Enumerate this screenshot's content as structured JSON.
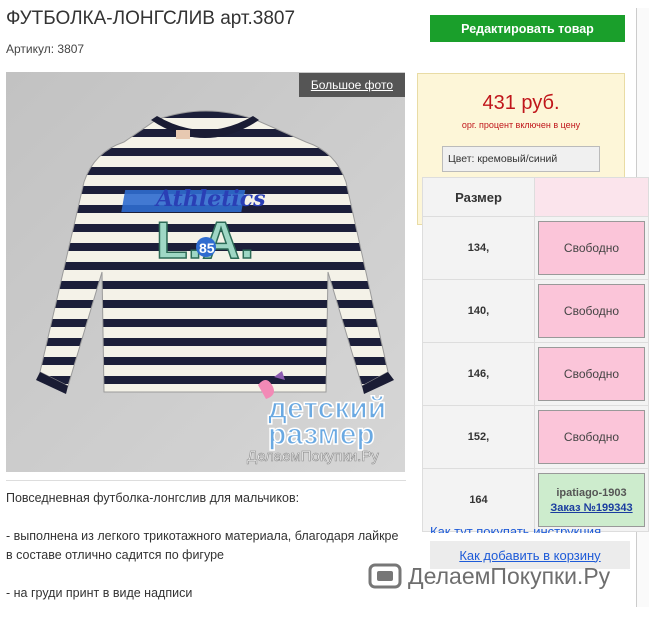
{
  "product": {
    "title": "ФУТБОЛКА-ЛОНГСЛИВ арт.3807",
    "sku": "Артикул: 3807",
    "big_photo": "Большое фото"
  },
  "image_text": {
    "brand_line1": "детский",
    "brand_line2": "размер",
    "brand_site": "ДелаемПокупки.Ру"
  },
  "actions": {
    "edit": "Редактировать товар"
  },
  "price": {
    "value": "431 руб.",
    "note": "орг. процент включен в цену",
    "color_label": "Цвет:",
    "color_value": "кремовый/синий"
  },
  "sizes": {
    "header": "Размер",
    "rows": [
      {
        "size": "134,",
        "status": "Свободно"
      },
      {
        "size": "140,",
        "status": "Свободно"
      },
      {
        "size": "146,",
        "status": "Свободно"
      },
      {
        "size": "152,",
        "status": "Свободно"
      },
      {
        "size": "164",
        "user": "ipatiago-1903",
        "order": "Заказ №199343"
      }
    ]
  },
  "links": {
    "how_to_buy": "Как тут покупать инструкция",
    "how_to_add": "Как добавить в корзину"
  },
  "description": {
    "intro": "Повседневная футболка-лонгслив для мальчиков:",
    "point1": "- выполнена из легкого трикотажного материала, благодаря лайкре в составе отлично садится по фигуре",
    "point2": "- на груди принт в виде надписи"
  },
  "watermark": "ДелаемПокупки.Ру",
  "colors": {
    "button_green": "#1a9f2b",
    "price_red": "#c0161b",
    "free_pink": "#fbc5d9",
    "taken_green": "#cdeccd",
    "link_blue": "#1e5bd8"
  }
}
